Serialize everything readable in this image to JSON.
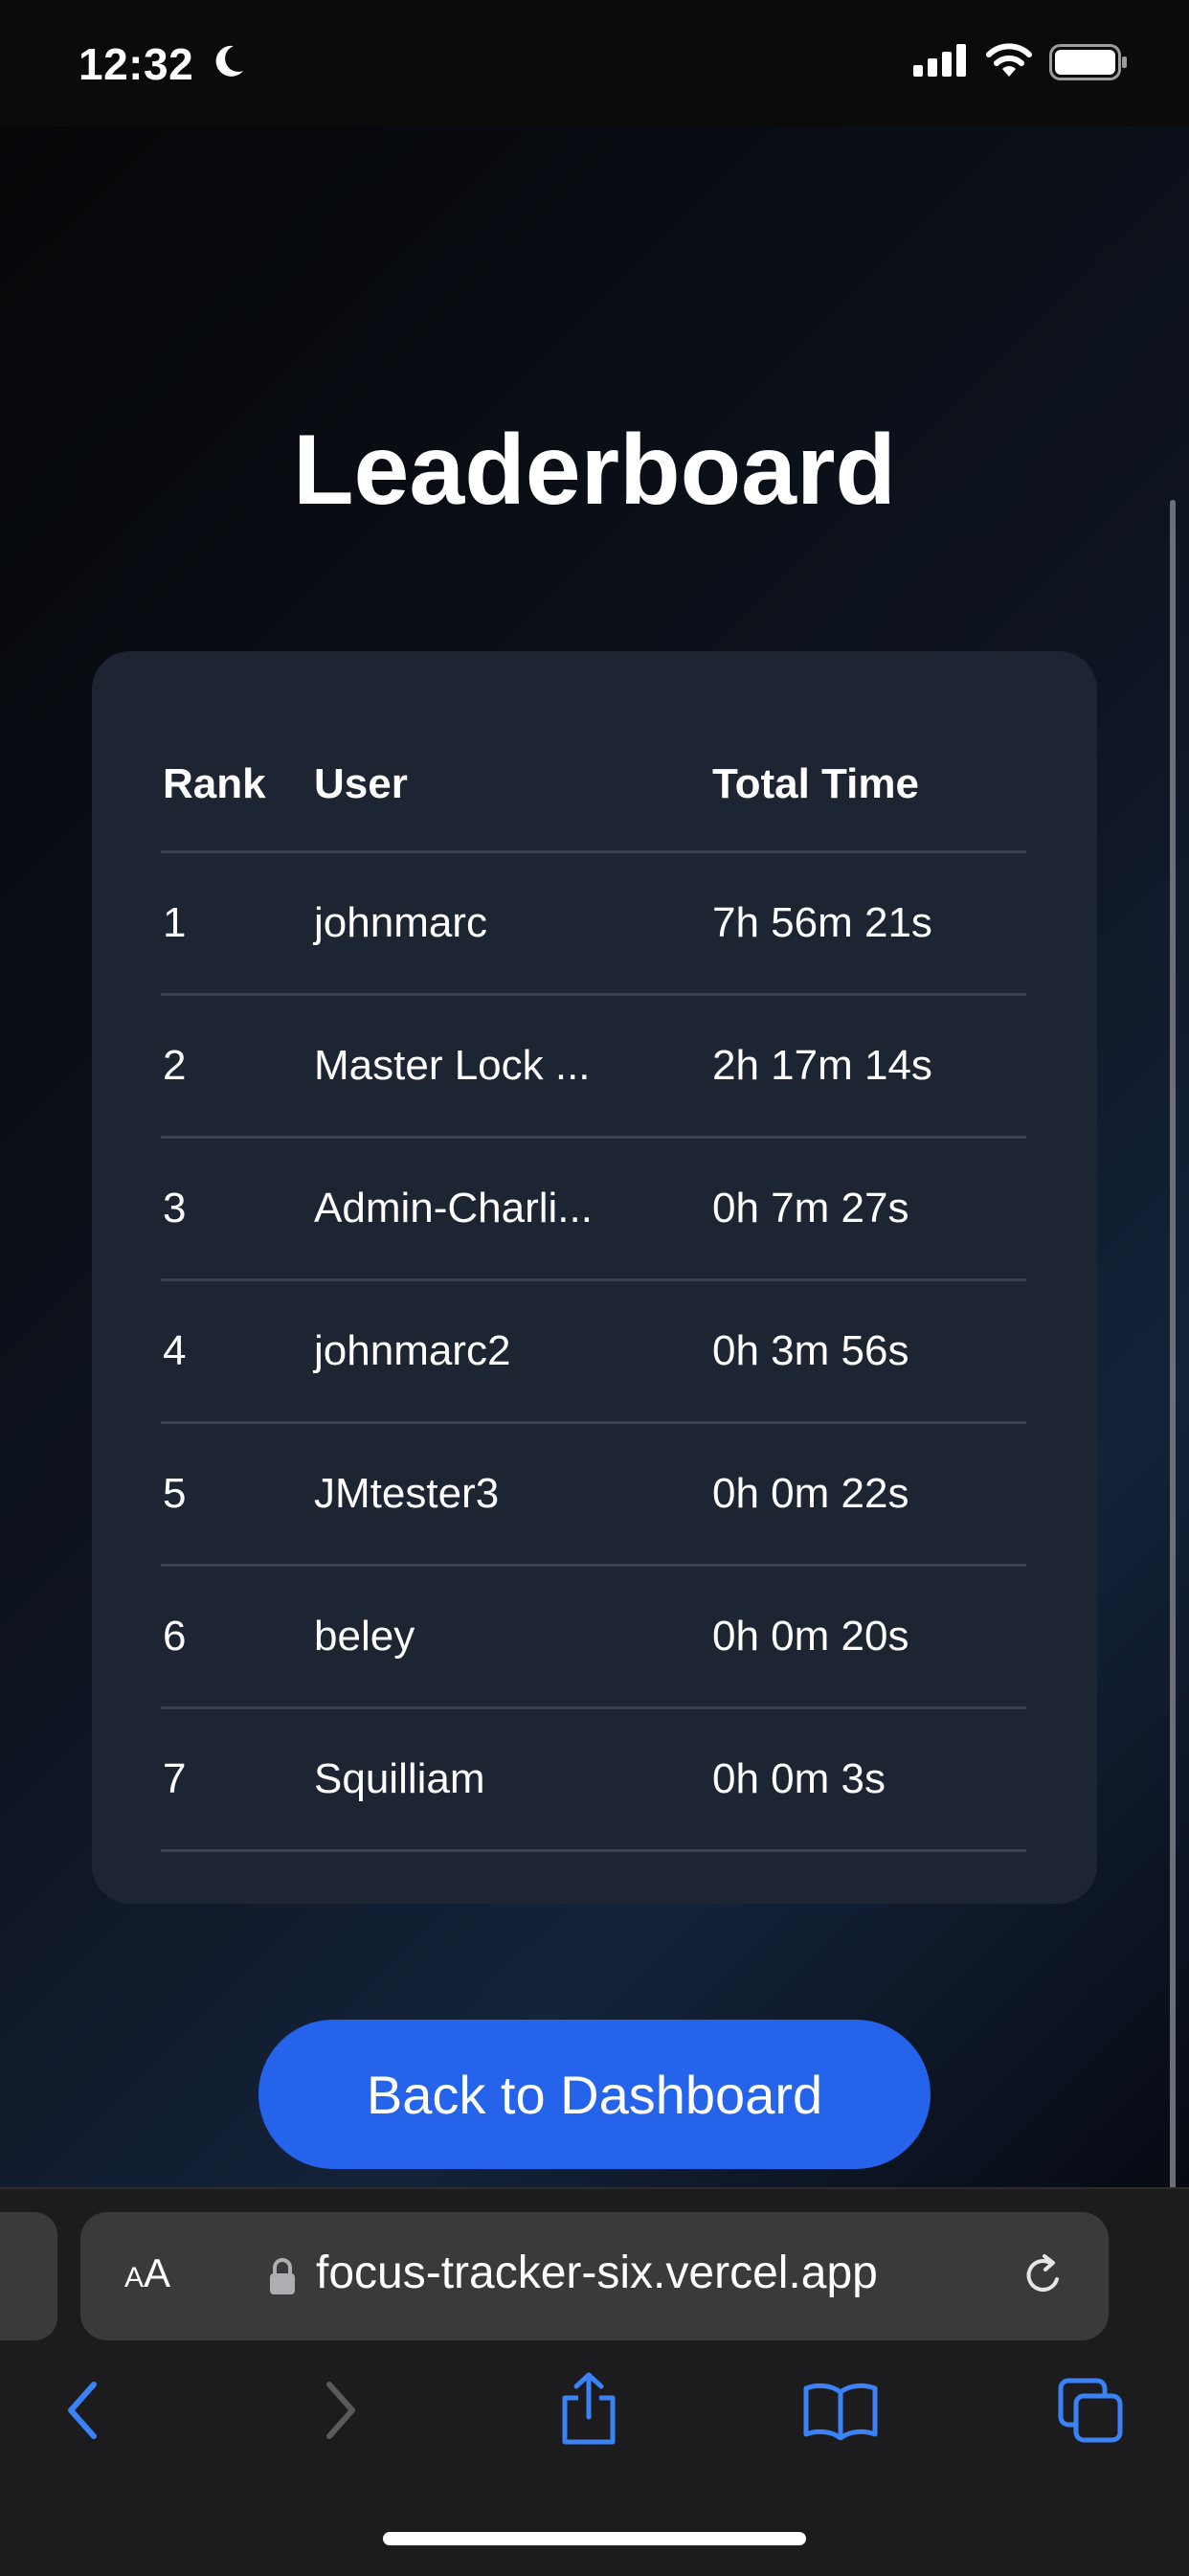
{
  "status_bar": {
    "time": "12:32",
    "icons": [
      "moon-icon",
      "signal-icon",
      "wifi-icon",
      "battery-icon"
    ]
  },
  "page": {
    "title": "Leaderboard",
    "table": {
      "headers": [
        "Rank",
        "User",
        "Total Time"
      ],
      "rows": [
        {
          "rank": "1",
          "user": "johnmarc",
          "time": "7h 56m 21s"
        },
        {
          "rank": "2",
          "user": "Master Lock ...",
          "time": "2h 17m 14s"
        },
        {
          "rank": "3",
          "user": "Admin-Charli...",
          "time": "0h 7m 27s"
        },
        {
          "rank": "4",
          "user": "johnmarc2",
          "time": "0h 3m 56s"
        },
        {
          "rank": "5",
          "user": "JMtester3",
          "time": "0h 0m 22s"
        },
        {
          "rank": "6",
          "user": "beley",
          "time": "0h 0m 20s"
        },
        {
          "rank": "7",
          "user": "Squilliam",
          "time": "0h 0m 3s"
        }
      ]
    },
    "back_button": "Back to Dashboard"
  },
  "browser": {
    "aa_big": "A",
    "aa_small": "A",
    "url": "focus-tracker-six.vercel.app",
    "toolbar_icons": [
      "back-icon",
      "forward-icon",
      "share-icon",
      "bookmarks-icon",
      "tabs-icon"
    ]
  },
  "colors": {
    "accent": "#2563eb",
    "card": "#1d2532",
    "toolbar_icon": "#3b82f6"
  }
}
